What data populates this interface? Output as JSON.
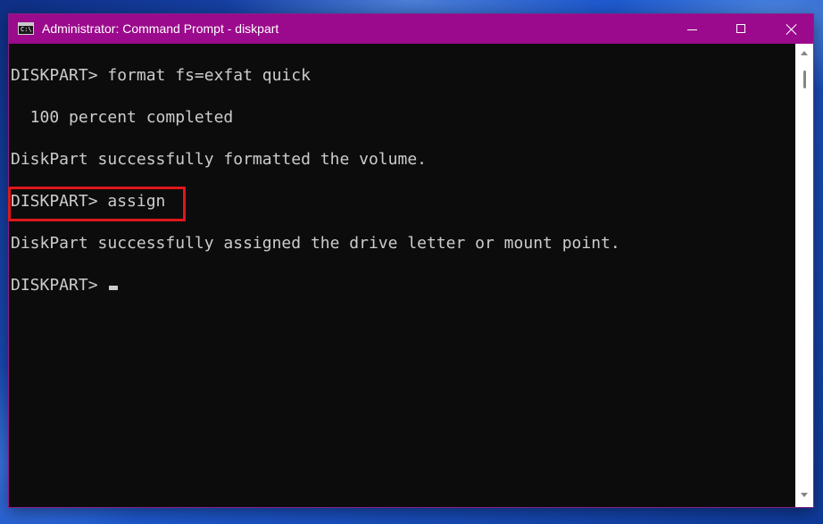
{
  "window": {
    "title": "Administrator: Command Prompt - diskpart",
    "icon": "cmd-icon",
    "icon_text": "C:\\",
    "controls": [
      "minimize-icon",
      "maximize-icon",
      "close-icon"
    ]
  },
  "console": {
    "lines": [
      "DISKPART> format fs=exfat quick",
      "  100 percent completed",
      "DiskPart successfully formatted the volume.",
      "DISKPART> assign",
      "DiskPart successfully assigned the drive letter or mount point.",
      "DISKPART> "
    ]
  },
  "colors": {
    "titlebar": "#9b0a8c",
    "console_bg": "#0c0c0c",
    "console_text": "#cccccc",
    "highlight": "#e0161a"
  }
}
